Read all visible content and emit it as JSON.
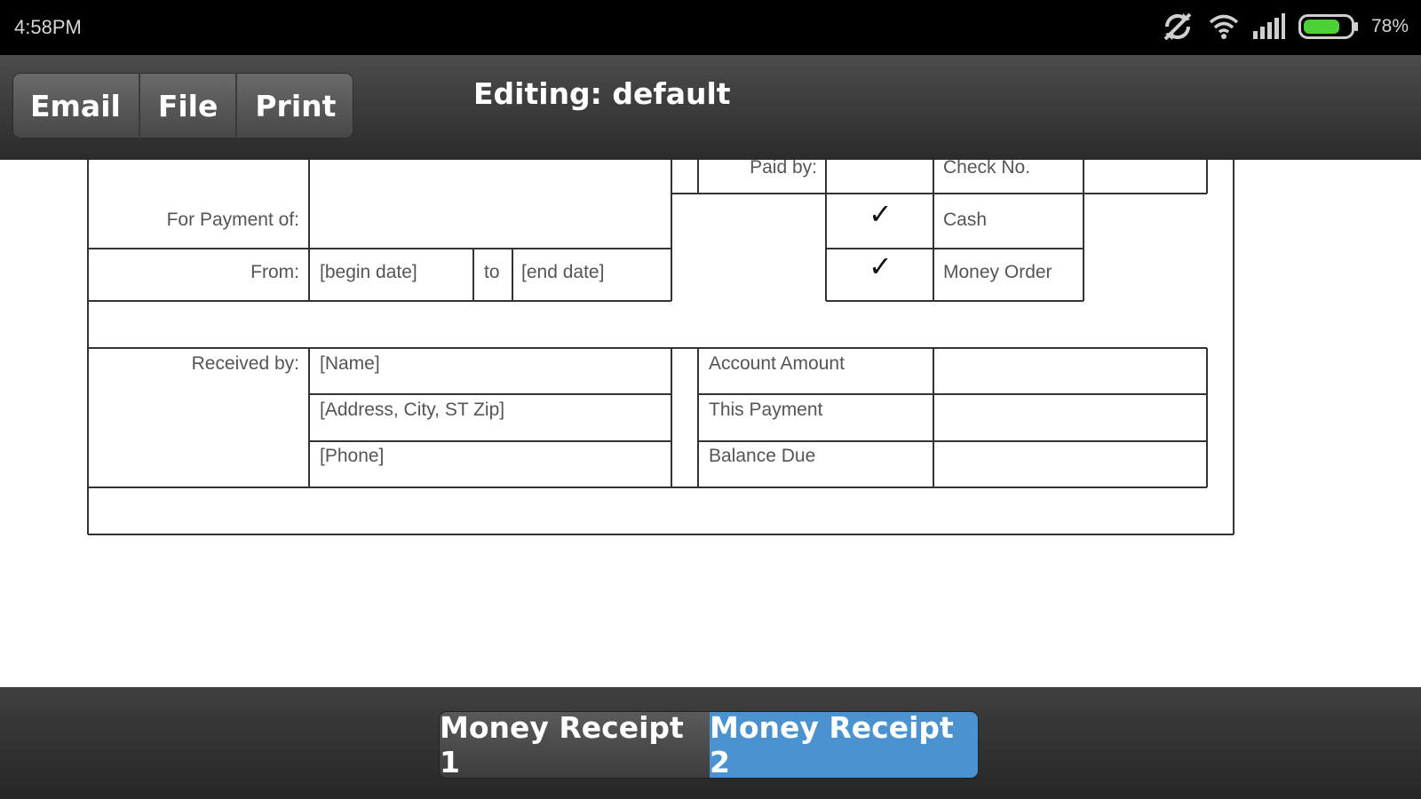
{
  "status_bar": {
    "time": "4:58PM",
    "battery_percent_label": "78%",
    "battery_level": 0.78,
    "icons": [
      "sync-off-icon",
      "wifi-icon",
      "signal-icon",
      "battery-icon"
    ]
  },
  "action_bar": {
    "buttons": [
      "Email",
      "File",
      "Print"
    ],
    "title": "Editing: default"
  },
  "form": {
    "for_payment_of_label": "For Payment of:",
    "from_label": "From:",
    "begin_date": "[begin date]",
    "to_label": "to",
    "end_date": "[end date]",
    "paid_by_label": "Paid by:",
    "check_no_label": "Check No.",
    "cash_label": "Cash",
    "money_order_label": "Money Order",
    "check_mark": "✓",
    "received_by_label": "Received by:",
    "name": "[Name]",
    "address": "[Address, City, ST  Zip]",
    "phone": "[Phone]",
    "account_amount_label": "Account Amount",
    "this_payment_label": "This Payment",
    "balance_due_label": "Balance Due"
  },
  "tabs": {
    "items": [
      "Money Receipt 1",
      "Money Receipt 2"
    ],
    "selected_index": 1
  },
  "colors": {
    "selected_tab": "#4a93d0",
    "battery_fill": "#4cd137"
  }
}
